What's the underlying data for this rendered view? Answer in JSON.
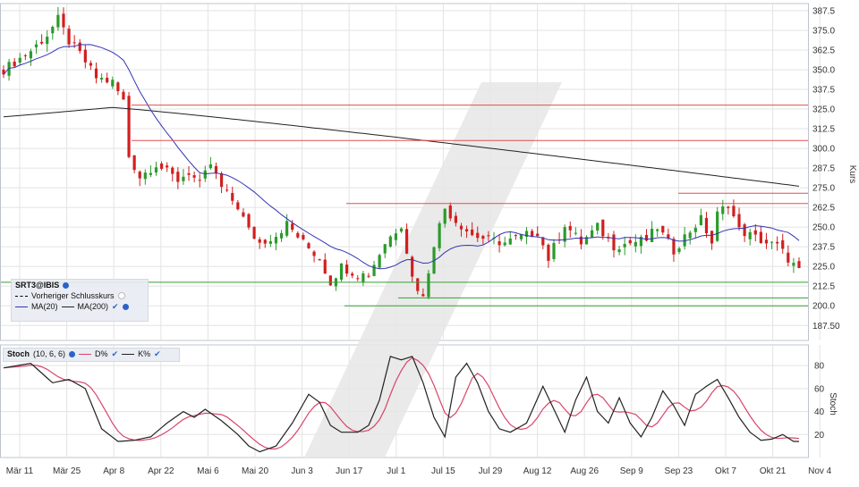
{
  "symbol": "SRT3@IBIS",
  "legend": {
    "prev_close_label": "Vorheriger Schlusskurs",
    "ma20_label": "MA(20)",
    "ma200_label": "MA(200)"
  },
  "stoch_legend": {
    "title": "Stoch",
    "params": "(10, 6, 6)",
    "d_label": "D%",
    "k_label": "K%"
  },
  "colors": {
    "up": "#2c9a2c",
    "down": "#d11f1f",
    "ma20": "#3535b5",
    "ma200": "#222222",
    "d_line": "#d9456a",
    "k_line": "#222222",
    "resistance": "#e05050",
    "support": "#33a033"
  },
  "chart_data": [
    {
      "type": "candlestick",
      "ylabel": "Kurs",
      "ylim": [
        178,
        392
      ],
      "yticks": [
        "387.5",
        "375.0",
        "362.5",
        "350.0",
        "337.5",
        "325.0",
        "312.5",
        "300.0",
        "287.5",
        "275.0",
        "262.5",
        "250.0",
        "237.5",
        "225.0",
        "212.5",
        "200.0",
        "187.50"
      ],
      "x_ticks": [
        "Mär 11",
        "Mär 25",
        "Apr 8",
        "Apr 22",
        "Mai 6",
        "Mai 20",
        "Jun 3",
        "Jun 17",
        "Jul 1",
        "Jul 15",
        "Jul 29",
        "Aug 12",
        "Aug 26",
        "Sep 9",
        "Sep 23",
        "Okt 7",
        "Okt 21",
        "Nov 4"
      ],
      "grid": true,
      "close_anchors": [
        [
          0,
          350
        ],
        [
          5,
          362
        ],
        [
          8,
          372
        ],
        [
          10,
          382
        ],
        [
          12,
          368
        ],
        [
          14,
          360
        ],
        [
          17,
          345
        ],
        [
          20,
          342
        ],
        [
          22,
          330
        ],
        [
          23,
          295
        ],
        [
          25,
          282
        ],
        [
          28,
          290
        ],
        [
          32,
          280
        ],
        [
          34,
          285
        ],
        [
          36,
          277
        ],
        [
          38,
          290
        ],
        [
          40,
          275
        ],
        [
          43,
          263
        ],
        [
          45,
          248
        ],
        [
          47,
          240
        ],
        [
          50,
          245
        ],
        [
          52,
          252
        ],
        [
          55,
          240
        ],
        [
          58,
          230
        ],
        [
          60,
          215
        ],
        [
          62,
          225
        ],
        [
          65,
          220
        ],
        [
          67,
          220
        ],
        [
          70,
          240
        ],
        [
          73,
          252
        ],
        [
          75,
          218
        ],
        [
          77,
          205
        ],
        [
          79,
          240
        ],
        [
          81,
          262
        ],
        [
          83,
          254
        ],
        [
          86,
          245
        ],
        [
          89,
          242
        ],
        [
          92,
          240
        ],
        [
          95,
          244
        ],
        [
          98,
          247
        ],
        [
          100,
          230
        ],
        [
          103,
          252
        ],
        [
          106,
          240
        ],
        [
          109,
          250
        ],
        [
          112,
          238
        ],
        [
          115,
          240
        ],
        [
          118,
          242
        ],
        [
          120,
          250
        ],
        [
          123,
          235
        ],
        [
          125,
          244
        ],
        [
          128,
          255
        ],
        [
          130,
          240
        ],
        [
          131,
          258
        ],
        [
          133,
          265
        ],
        [
          135,
          248
        ],
        [
          137,
          245
        ],
        [
          140,
          240
        ],
        [
          142,
          238
        ],
        [
          144,
          230
        ],
        [
          146,
          222
        ]
      ],
      "horizontal_lines": {
        "resistance": [
          327.5,
          305.0,
          271.5,
          265.0
        ],
        "support": [
          215.0,
          205.0,
          200.0
        ]
      },
      "series": [
        {
          "name": "MA(20)"
        },
        {
          "name": "MA(200)"
        }
      ]
    },
    {
      "type": "line",
      "ylabel": "Stoch",
      "ylim": [
        0,
        98
      ],
      "yticks": [
        "80",
        "60",
        "40",
        "20"
      ],
      "k_anchors": [
        [
          0,
          78
        ],
        [
          5,
          82
        ],
        [
          9,
          65
        ],
        [
          12,
          68
        ],
        [
          15,
          60
        ],
        [
          18,
          25
        ],
        [
          21,
          14
        ],
        [
          24,
          15
        ],
        [
          27,
          18
        ],
        [
          30,
          30
        ],
        [
          33,
          40
        ],
        [
          35,
          35
        ],
        [
          37,
          42
        ],
        [
          40,
          32
        ],
        [
          43,
          20
        ],
        [
          45,
          10
        ],
        [
          47,
          5
        ],
        [
          50,
          10
        ],
        [
          53,
          30
        ],
        [
          56,
          55
        ],
        [
          58,
          48
        ],
        [
          60,
          28
        ],
        [
          62,
          22
        ],
        [
          65,
          22
        ],
        [
          67,
          28
        ],
        [
          69,
          50
        ],
        [
          71,
          88
        ],
        [
          73,
          85
        ],
        [
          75,
          88
        ],
        [
          77,
          65
        ],
        [
          79,
          35
        ],
        [
          81,
          18
        ],
        [
          83,
          70
        ],
        [
          85,
          82
        ],
        [
          87,
          65
        ],
        [
          89,
          40
        ],
        [
          91,
          25
        ],
        [
          93,
          22
        ],
        [
          96,
          30
        ],
        [
          99,
          62
        ],
        [
          101,
          42
        ],
        [
          103,
          22
        ],
        [
          105,
          50
        ],
        [
          107,
          70
        ],
        [
          109,
          40
        ],
        [
          111,
          30
        ],
        [
          113,
          52
        ],
        [
          115,
          30
        ],
        [
          117,
          18
        ],
        [
          119,
          35
        ],
        [
          121,
          58
        ],
        [
          123,
          45
        ],
        [
          125,
          28
        ],
        [
          127,
          55
        ],
        [
          129,
          62
        ],
        [
          131,
          68
        ],
        [
          133,
          52
        ],
        [
          135,
          35
        ],
        [
          137,
          22
        ],
        [
          139,
          15
        ],
        [
          141,
          16
        ],
        [
          143,
          20
        ],
        [
          145,
          14
        ]
      ],
      "series": [
        {
          "name": "D%"
        },
        {
          "name": "K%"
        }
      ]
    }
  ]
}
